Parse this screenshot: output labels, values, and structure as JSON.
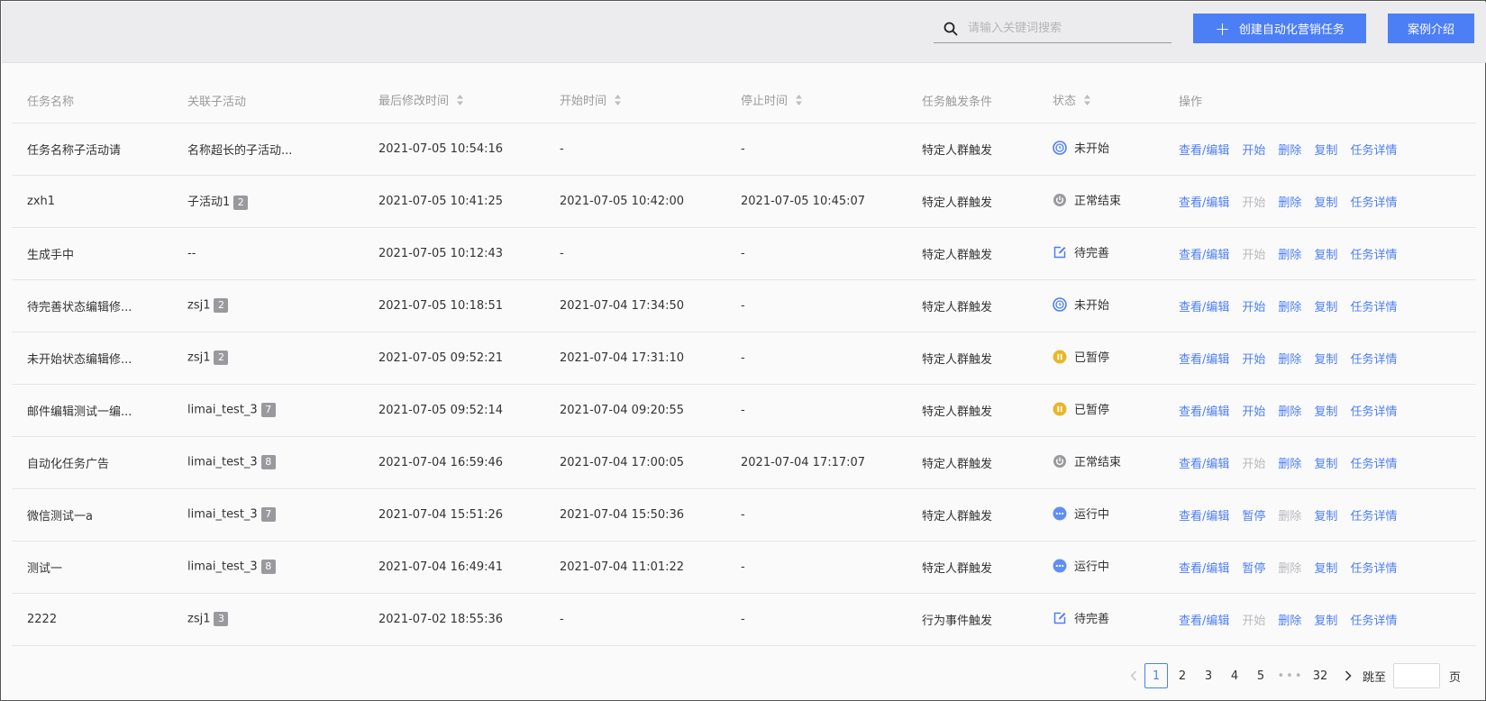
{
  "search": {
    "placeholder": "请输入关键词搜索"
  },
  "toolbar": {
    "create_label": "创建自动化营销任务",
    "case_label": "案例介绍"
  },
  "colors": {
    "accent": "#4c7ef6",
    "disabled": "#b9b9bd",
    "paused": "#e9b625",
    "ended": "#9a9a9e"
  },
  "columns": [
    "任务名称",
    "关联子活动",
    "最后修改时间",
    "开始时间",
    "停止时间",
    "任务触发条件",
    "状态",
    "操作"
  ],
  "rows": [
    {
      "name": "任务名称子活动请",
      "activity": "名称超长的子活动...",
      "badge": "",
      "modified": "2021-07-05 10:54:16",
      "start": "-",
      "stop": "-",
      "trigger": "特定人群触发",
      "status": "未开始",
      "status_icon": "clock-icon",
      "actions": [
        {
          "label": "查看/编辑",
          "enabled": true
        },
        {
          "label": "开始",
          "enabled": true
        },
        {
          "label": "删除",
          "enabled": true
        },
        {
          "label": "复制",
          "enabled": true
        },
        {
          "label": "任务详情",
          "enabled": true
        }
      ]
    },
    {
      "name": "zxh1",
      "activity": "子活动1",
      "badge": "2",
      "modified": "2021-07-05 10:41:25",
      "start": "2021-07-05 10:42:00",
      "stop": "2021-07-05 10:45:07",
      "trigger": "特定人群触发",
      "status": "正常结束",
      "status_icon": "power-icon",
      "actions": [
        {
          "label": "查看/编辑",
          "enabled": true
        },
        {
          "label": "开始",
          "enabled": false
        },
        {
          "label": "删除",
          "enabled": true
        },
        {
          "label": "复制",
          "enabled": true
        },
        {
          "label": "任务详情",
          "enabled": true
        }
      ]
    },
    {
      "name": "生成手中",
      "activity": "--",
      "badge": "",
      "modified": "2021-07-05 10:12:43",
      "start": "-",
      "stop": "-",
      "trigger": "特定人群触发",
      "status": "待完善",
      "status_icon": "edit-icon",
      "actions": [
        {
          "label": "查看/编辑",
          "enabled": true
        },
        {
          "label": "开始",
          "enabled": false
        },
        {
          "label": "删除",
          "enabled": true
        },
        {
          "label": "复制",
          "enabled": true
        },
        {
          "label": "任务详情",
          "enabled": true
        }
      ]
    },
    {
      "name": "待完善状态编辑修...",
      "activity": "zsj1",
      "badge": "2",
      "modified": "2021-07-05 10:18:51",
      "start": "2021-07-04 17:34:50",
      "stop": "-",
      "trigger": "特定人群触发",
      "status": "未开始",
      "status_icon": "clock-icon",
      "actions": [
        {
          "label": "查看/编辑",
          "enabled": true
        },
        {
          "label": "开始",
          "enabled": true
        },
        {
          "label": "删除",
          "enabled": true
        },
        {
          "label": "复制",
          "enabled": true
        },
        {
          "label": "任务详情",
          "enabled": true
        }
      ]
    },
    {
      "name": "未开始状态编辑修...",
      "activity": "zsj1",
      "badge": "2",
      "modified": "2021-07-05 09:52:21",
      "start": "2021-07-04 17:31:10",
      "stop": "-",
      "trigger": "特定人群触发",
      "status": "已暂停",
      "status_icon": "pause-icon",
      "actions": [
        {
          "label": "查看/编辑",
          "enabled": true
        },
        {
          "label": "开始",
          "enabled": true
        },
        {
          "label": "删除",
          "enabled": true
        },
        {
          "label": "复制",
          "enabled": true
        },
        {
          "label": "任务详情",
          "enabled": true
        }
      ]
    },
    {
      "name": "邮件编辑测试一编...",
      "activity": "limai_test_3",
      "badge": "7",
      "modified": "2021-07-05 09:52:14",
      "start": "2021-07-04 09:20:55",
      "stop": "-",
      "trigger": "特定人群触发",
      "status": "已暂停",
      "status_icon": "pause-icon",
      "actions": [
        {
          "label": "查看/编辑",
          "enabled": true
        },
        {
          "label": "开始",
          "enabled": true
        },
        {
          "label": "删除",
          "enabled": true
        },
        {
          "label": "复制",
          "enabled": true
        },
        {
          "label": "任务详情",
          "enabled": true
        }
      ]
    },
    {
      "name": "自动化任务广告",
      "activity": "limai_test_3",
      "badge": "8",
      "modified": "2021-07-04 16:59:46",
      "start": "2021-07-04 17:00:05",
      "stop": "2021-07-04 17:17:07",
      "trigger": "特定人群触发",
      "status": "正常结束",
      "status_icon": "power-icon",
      "actions": [
        {
          "label": "查看/编辑",
          "enabled": true
        },
        {
          "label": "开始",
          "enabled": false
        },
        {
          "label": "删除",
          "enabled": true
        },
        {
          "label": "复制",
          "enabled": true
        },
        {
          "label": "任务详情",
          "enabled": true
        }
      ]
    },
    {
      "name": "微信测试一a",
      "activity": "limai_test_3",
      "badge": "7",
      "modified": "2021-07-04 15:51:26",
      "start": "2021-07-04 15:50:36",
      "stop": "-",
      "trigger": "特定人群触发",
      "status": "运行中",
      "status_icon": "running-icon",
      "actions": [
        {
          "label": "查看/编辑",
          "enabled": true
        },
        {
          "label": "暂停",
          "enabled": true
        },
        {
          "label": "删除",
          "enabled": false
        },
        {
          "label": "复制",
          "enabled": true
        },
        {
          "label": "任务详情",
          "enabled": true
        }
      ]
    },
    {
      "name": "测试一",
      "activity": "limai_test_3",
      "badge": "8",
      "modified": "2021-07-04 16:49:41",
      "start": "2021-07-04 11:01:22",
      "stop": "-",
      "trigger": "特定人群触发",
      "status": "运行中",
      "status_icon": "running-icon",
      "actions": [
        {
          "label": "查看/编辑",
          "enabled": true
        },
        {
          "label": "暂停",
          "enabled": true
        },
        {
          "label": "删除",
          "enabled": false
        },
        {
          "label": "复制",
          "enabled": true
        },
        {
          "label": "任务详情",
          "enabled": true
        }
      ]
    },
    {
      "name": "2222",
      "activity": "zsj1",
      "badge": "3",
      "modified": "2021-07-02 18:55:36",
      "start": "-",
      "stop": "-",
      "trigger": "行为事件触发",
      "status": "待完善",
      "status_icon": "edit-icon",
      "actions": [
        {
          "label": "查看/编辑",
          "enabled": true
        },
        {
          "label": "开始",
          "enabled": false
        },
        {
          "label": "删除",
          "enabled": true
        },
        {
          "label": "复制",
          "enabled": true
        },
        {
          "label": "任务详情",
          "enabled": true
        }
      ]
    }
  ],
  "pagination": {
    "current": "1",
    "pages": [
      "1",
      "2",
      "3",
      "4",
      "5"
    ],
    "ellipsis": "•••",
    "last": "32",
    "goto_label": "跳至",
    "unit": "页"
  }
}
